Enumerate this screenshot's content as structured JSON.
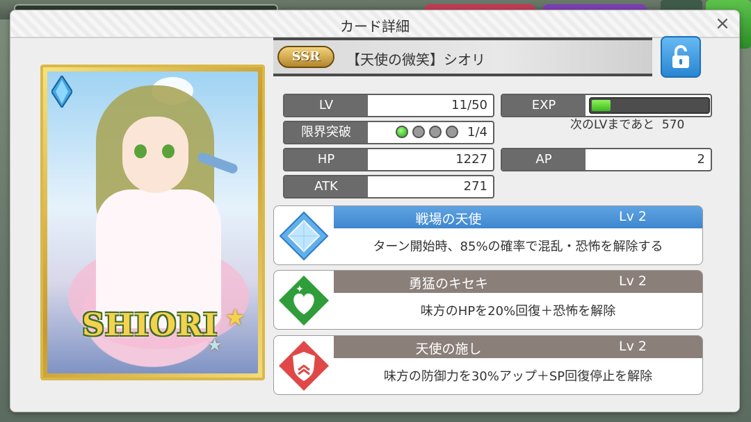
{
  "modal": {
    "title": "カード詳細",
    "close_glyph": "×"
  },
  "card": {
    "rarity": "SSR",
    "title": "【天使の微笑】シオリ",
    "art_name": "SHIORI"
  },
  "stats": {
    "lv_label": "LV",
    "lv_value": "11/50",
    "exp_label": "EXP",
    "exp_progress": 0.16,
    "limit_label": "限界突破",
    "limit_value": "1/4",
    "limit_filled": 1,
    "limit_total": 4,
    "next_lv_text": "次のLVまであと",
    "next_lv_value": "570",
    "hp_label": "HP",
    "hp_value": "1227",
    "ap_label": "AP",
    "ap_value": "2",
    "atk_label": "ATK",
    "atk_value": "271"
  },
  "skills": [
    {
      "name": "戦場の天使",
      "level": "Lv 2",
      "desc": "ターン開始時、85%の確率で混乱・恐怖を解除する",
      "icon": "blue-diamond-icon",
      "color": "#4a8fd8"
    },
    {
      "name": "勇猛のキセキ",
      "level": "Lv 2",
      "desc": "味方のHPを20%回復＋恐怖を解除",
      "icon": "green-heart-icon",
      "color": "#2f9d3a"
    },
    {
      "name": "天使の施し",
      "level": "Lv 2",
      "desc": "味方の防御力を30%アップ＋SP回復停止を解除",
      "icon": "red-shield-icon",
      "color": "#d93c3c"
    }
  ]
}
